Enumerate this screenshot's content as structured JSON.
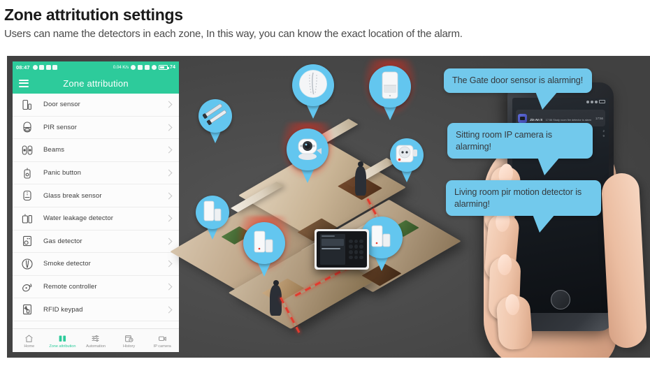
{
  "heading": {
    "title": "Zone attritution settings",
    "subtitle": "Users can name the detectors in each zone, In this way, you can know the exact location of the alarm."
  },
  "colors": {
    "app_accent": "#2dcb9b",
    "bubble": "#72c9ec",
    "pin": "#63c6ef",
    "alarm_red": "#e23b2e",
    "panel_bg": "#494949"
  },
  "app": {
    "status_bar": {
      "time": "08:47",
      "data_rate": "0.04 K/s",
      "battery_level": "74",
      "icons": [
        "emoji-icon",
        "screenshot-icon",
        "gallery-icon",
        "sdcard-icon",
        "alarm-clock-icon",
        "wifi-icon",
        "signal-icon",
        "sync-icon",
        "battery-icon"
      ]
    },
    "header": {
      "menu_icon": "hamburger-icon",
      "title": "Zone attribution"
    },
    "list": [
      {
        "label": "Door sensor",
        "icon": "door-sensor-icon"
      },
      {
        "label": "PIR sensor",
        "icon": "pir-sensor-icon"
      },
      {
        "label": "Beams",
        "icon": "beams-icon"
      },
      {
        "label": "Panic button",
        "icon": "panic-button-icon"
      },
      {
        "label": "Glass break sensor",
        "icon": "glass-break-icon"
      },
      {
        "label": "Water leakage detector",
        "icon": "water-leakage-icon"
      },
      {
        "label": "Gas detector",
        "icon": "gas-detector-icon"
      },
      {
        "label": "Smoke detector",
        "icon": "smoke-detector-icon"
      },
      {
        "label": "Remote controller",
        "icon": "remote-controller-icon"
      },
      {
        "label": "RFID keypad",
        "icon": "rfid-keypad-icon"
      }
    ],
    "tabs": [
      {
        "label": "Home",
        "icon": "home-icon",
        "active": false
      },
      {
        "label": "Zone attribution",
        "icon": "zone-icon",
        "active": true
      },
      {
        "label": "Automation",
        "icon": "sliders-icon",
        "active": false
      },
      {
        "label": "History",
        "icon": "history-icon",
        "active": false
      },
      {
        "label": "IP camera",
        "icon": "camera-icon",
        "active": false
      }
    ]
  },
  "scene": {
    "description": "3D isometric cutaway house with smart security devices",
    "pins": [
      {
        "device": "beam-barrier-sensor",
        "alarming": false
      },
      {
        "device": "smoke-detector",
        "alarming": false
      },
      {
        "device": "pir-motion-detector",
        "alarming": true
      },
      {
        "device": "ip-camera",
        "alarming": true
      },
      {
        "device": "smart-plug",
        "alarming": false
      },
      {
        "device": "door-contact-sensor-left",
        "alarming": false
      },
      {
        "device": "door-contact-sensor-center",
        "alarming": true
      },
      {
        "device": "door-contact-sensor-right",
        "alarming": false
      }
    ],
    "alarm_panel": {
      "name": "alarm-control-panel",
      "keys": [
        "1",
        "2",
        "3",
        "4",
        "5",
        "6",
        "7",
        "8",
        "9",
        "*",
        "0",
        "#"
      ]
    }
  },
  "phone_mockup": {
    "notification": {
      "app_name": "Jin An S",
      "message": "17:56 Study room fire detector is alarm",
      "time": "17:56"
    },
    "row_times": [
      "2",
      "9"
    ]
  },
  "bubbles": [
    {
      "text": "The Gate door sensor is alarming!"
    },
    {
      "text": "Sitting room IP camera is alarming!"
    },
    {
      "text": "Living room pir motion detector is alarming!"
    }
  ]
}
